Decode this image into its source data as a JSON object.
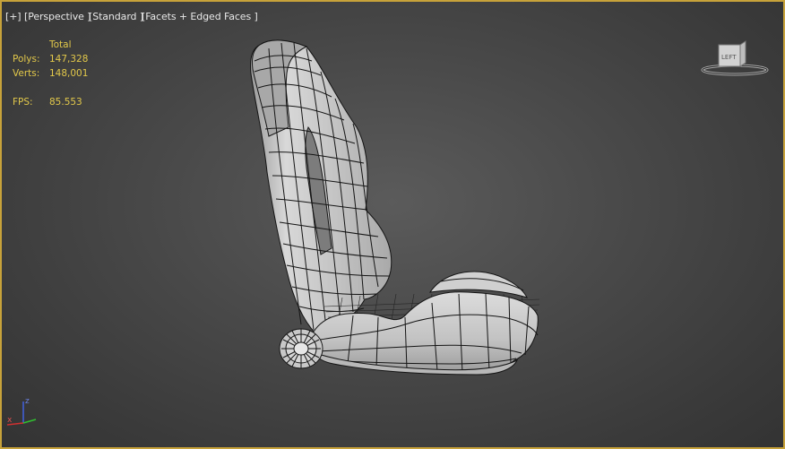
{
  "viewport": {
    "menu_label": "[+]",
    "view_label": "[Perspective ]",
    "shading_label": "[Standard ]",
    "display_label": "[Facets + Edged Faces ]"
  },
  "stats": {
    "total_header": "Total",
    "polys_label": "Polys:",
    "polys_value": "147,328",
    "verts_label": "Verts:",
    "verts_value": "148,001",
    "fps_label": "FPS:",
    "fps_value": "85.553"
  },
  "viewcube": {
    "face_label": "LEFT"
  },
  "axis_gizmo": {
    "z_label": "z",
    "x_label": "x"
  },
  "colors": {
    "accent": "#c7a23a",
    "stats": "#e2c84a",
    "x_axis": "#d03030",
    "y_axis": "#30c030",
    "z_axis": "#4060e0"
  }
}
